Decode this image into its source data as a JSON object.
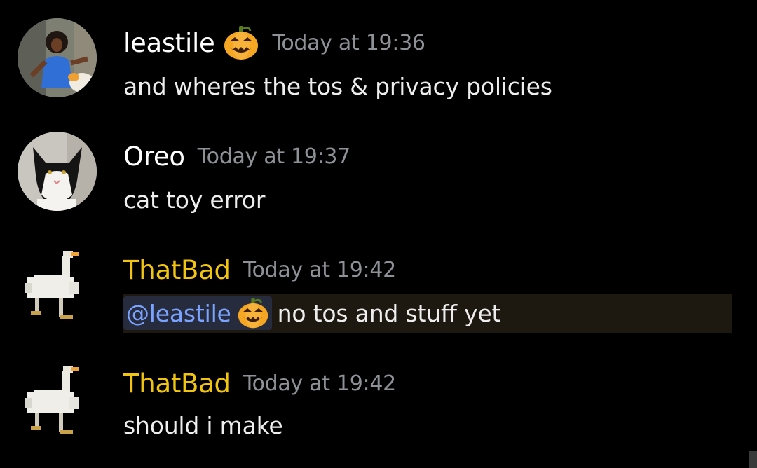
{
  "messages": [
    {
      "username": "leastile",
      "username_color": "#ffffff",
      "timestamp": "Today at 19:36",
      "text": "and wheres the tos & privacy policies",
      "avatar": "woman-dancing-photo",
      "badge": "jack-o-lantern-icon"
    },
    {
      "username": "Oreo",
      "username_color": "#ffffff",
      "timestamp": "Today at 19:37",
      "text": "cat toy error",
      "avatar": "black-white-cat-photo"
    },
    {
      "username": "ThatBad",
      "username_color": "#f1c40f",
      "timestamp": "Today at 19:42",
      "mention": "@leastile",
      "mention_badge": "jack-o-lantern-icon",
      "text": "no tos and stuff yet",
      "avatar": "pixel-goose-icon",
      "highlighted": true
    },
    {
      "username": "ThatBad",
      "username_color": "#f1c40f",
      "timestamp": "Today at 19:42",
      "text": "should i make",
      "avatar": "pixel-goose-icon"
    }
  ],
  "colors": {
    "background": "#000000",
    "timestamp": "#8e9297",
    "mention_text": "#7aa2ff",
    "mention_bg": "#262b3d",
    "highlight_bg": "#1d1910"
  }
}
